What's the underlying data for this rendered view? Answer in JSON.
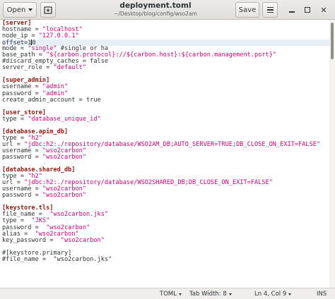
{
  "header": {
    "open_label": "Open",
    "title": "deployment.toml",
    "subtitle": "~/Desktop/blog/config/wso2am",
    "save_label": "Save",
    "close_glyph": "✕",
    "icons": [
      "new-tab-icon",
      "hamburger-menu-icon",
      "minimize-icon",
      "maximize-icon",
      "close-icon"
    ]
  },
  "editor": {
    "lines": [
      [
        {
          "t": "[server]",
          "c": "sec"
        }
      ],
      [
        {
          "t": "hostname = ",
          "c": "key"
        },
        {
          "t": "\"localhost\"",
          "c": "str"
        }
      ],
      [
        {
          "t": "node_ip = ",
          "c": "key"
        },
        {
          "t": "\"127.0.0.1\"",
          "c": "str"
        }
      ],
      [
        {
          "t": "offset=1",
          "c": "key"
        },
        {
          "t": "|",
          "c": "cursor"
        },
        {
          "t": "0",
          "c": "key"
        }
      ],
      [
        {
          "t": "mode = ",
          "c": "key"
        },
        {
          "t": "\"single\"",
          "c": "str"
        },
        {
          "t": " #single or ha",
          "c": "key"
        }
      ],
      [
        {
          "t": "base_path = ",
          "c": "key"
        },
        {
          "t": "\"${carbon.protocol}://${carbon.host}:${carbon.management.port}\"",
          "c": "str"
        }
      ],
      [
        {
          "t": "#discard_empty_caches = false",
          "c": "key"
        }
      ],
      [
        {
          "t": "server_role = ",
          "c": "key"
        },
        {
          "t": "\"default\"",
          "c": "str"
        }
      ],
      [],
      [
        {
          "t": "[super_admin]",
          "c": "sec"
        }
      ],
      [
        {
          "t": "username = ",
          "c": "key"
        },
        {
          "t": "\"admin\"",
          "c": "str"
        }
      ],
      [
        {
          "t": "password = ",
          "c": "key"
        },
        {
          "t": "\"admin\"",
          "c": "str"
        }
      ],
      [
        {
          "t": "create_admin_account = true",
          "c": "key"
        }
      ],
      [],
      [
        {
          "t": "[user_store]",
          "c": "sec"
        }
      ],
      [
        {
          "t": "type = ",
          "c": "key"
        },
        {
          "t": "\"database_unique_id\"",
          "c": "str"
        }
      ],
      [],
      [
        {
          "t": "[database.apim_db]",
          "c": "sec"
        }
      ],
      [
        {
          "t": "type = ",
          "c": "key"
        },
        {
          "t": "\"h2\"",
          "c": "str"
        }
      ],
      [
        {
          "t": "url = ",
          "c": "key"
        },
        {
          "t": "\"jdbc:h2:./repository/database/WSO2AM_DB;AUTO_SERVER=TRUE;DB_CLOSE_ON_EXIT=FALSE\"",
          "c": "str"
        }
      ],
      [
        {
          "t": "username = ",
          "c": "key"
        },
        {
          "t": "\"wso2carbon\"",
          "c": "str"
        }
      ],
      [
        {
          "t": "password = ",
          "c": "key"
        },
        {
          "t": "\"wso2carbon\"",
          "c": "str"
        }
      ],
      [],
      [
        {
          "t": "[database.shared_db]",
          "c": "sec"
        }
      ],
      [
        {
          "t": "type = ",
          "c": "key"
        },
        {
          "t": "\"h2\"",
          "c": "str"
        }
      ],
      [
        {
          "t": "url = ",
          "c": "key"
        },
        {
          "t": "\"jdbc:h2:./repository/database/WSO2SHARED_DB;DB_CLOSE_ON_EXIT=FALSE\"",
          "c": "str"
        }
      ],
      [
        {
          "t": "username = ",
          "c": "key"
        },
        {
          "t": "\"wso2carbon\"",
          "c": "str"
        }
      ],
      [
        {
          "t": "password = ",
          "c": "key"
        },
        {
          "t": "\"wso2carbon\"",
          "c": "str"
        }
      ],
      [],
      [
        {
          "t": "[keystore.tls]",
          "c": "sec"
        }
      ],
      [
        {
          "t": "file_name =  ",
          "c": "key"
        },
        {
          "t": "\"wso2carbon.jks\"",
          "c": "str"
        }
      ],
      [
        {
          "t": "type =  ",
          "c": "key"
        },
        {
          "t": "\"JKS\"",
          "c": "str"
        }
      ],
      [
        {
          "t": "password =  ",
          "c": "key"
        },
        {
          "t": "\"wso2carbon\"",
          "c": "str"
        }
      ],
      [
        {
          "t": "alias =  ",
          "c": "key"
        },
        {
          "t": "\"wso2carbon\"",
          "c": "str"
        }
      ],
      [
        {
          "t": "key_password =  ",
          "c": "key"
        },
        {
          "t": "\"wso2carbon\"",
          "c": "str"
        }
      ],
      [],
      [
        {
          "t": "#[keystore.primary]",
          "c": "key"
        }
      ],
      [
        {
          "t": "#file_name =  \"wso2carbon.jks\"",
          "c": "key"
        }
      ]
    ],
    "current_line": 3
  },
  "statusbar": {
    "language": "TOML",
    "tab_width": "Tab Width: 8",
    "position": "Ln 4, Col 9",
    "mode": "INS"
  }
}
